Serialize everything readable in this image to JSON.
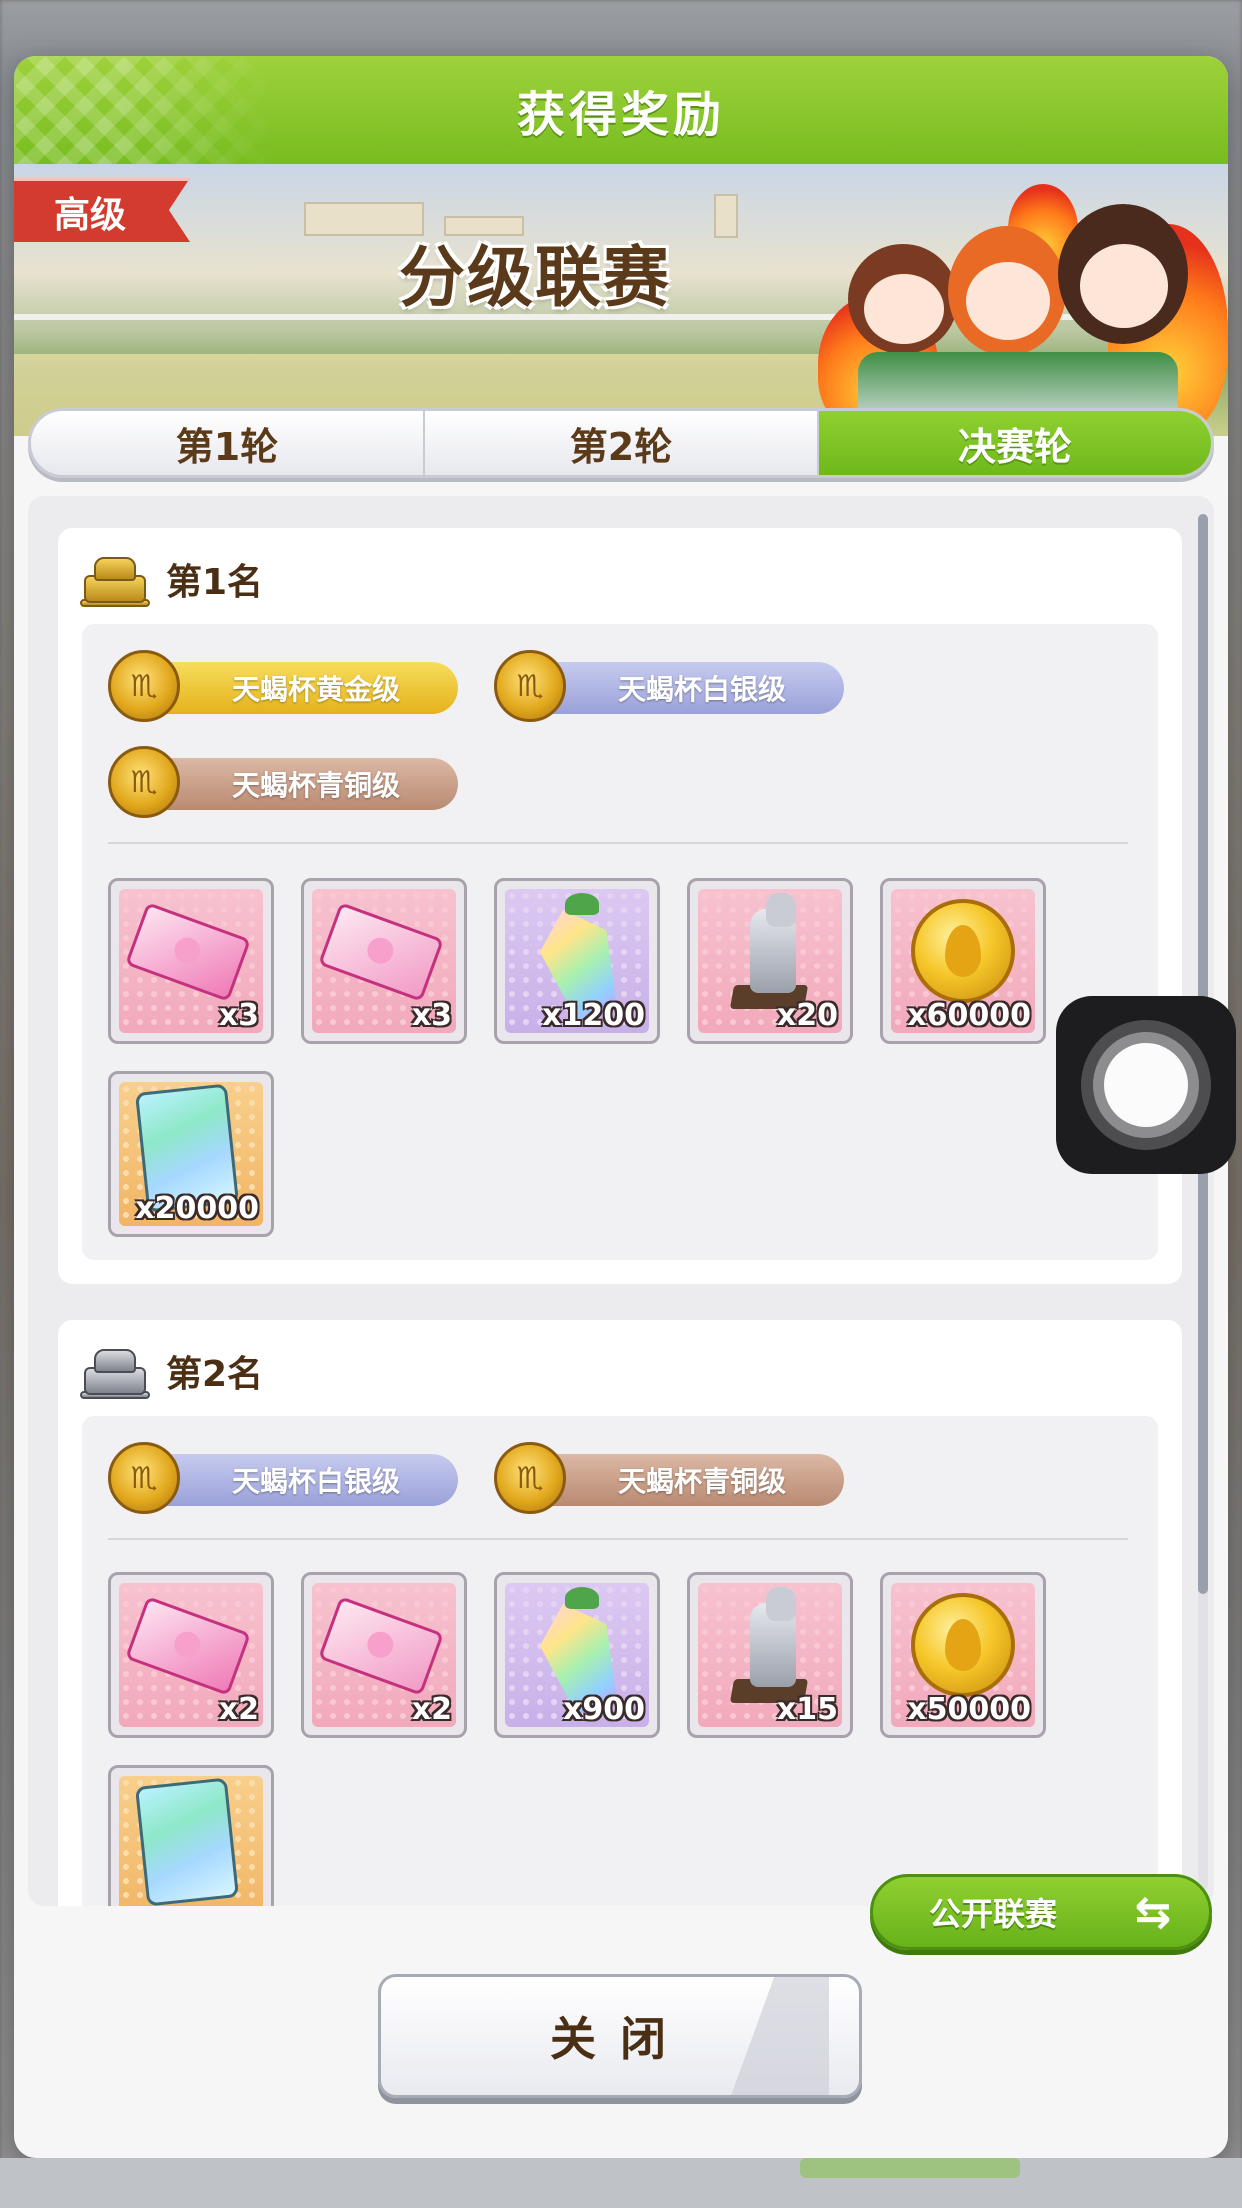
{
  "dialog": {
    "title": "获得奖励",
    "banner": {
      "grade": "高级",
      "title": "分级联赛"
    },
    "tabs": [
      {
        "label": "第1轮",
        "active": false
      },
      {
        "label": "第2轮",
        "active": false
      },
      {
        "label": "决赛轮",
        "active": true
      }
    ],
    "ranks": [
      {
        "label": "第1名",
        "trophy": "gold-trophy-icon",
        "badges": [
          {
            "label": "天蝎杯黄金级",
            "tier": "gold"
          },
          {
            "label": "天蝎杯白银级",
            "tier": "silver"
          },
          {
            "label": "天蝎杯青铜级",
            "tier": "bronze"
          }
        ],
        "items": [
          {
            "icon": "pink-ticket-icon",
            "qty": "x3"
          },
          {
            "icon": "pink-ticket-icon",
            "qty": "x3"
          },
          {
            "icon": "carrot-gem-icon",
            "qty": "x1200"
          },
          {
            "icon": "silver-statue-icon",
            "qty": "x20"
          },
          {
            "icon": "gold-coin-icon",
            "qty": "x60000"
          },
          {
            "icon": "rainbow-card-icon",
            "qty": "x20000"
          }
        ]
      },
      {
        "label": "第2名",
        "trophy": "silver-trophy-icon",
        "badges": [
          {
            "label": "天蝎杯白银级",
            "tier": "silver"
          },
          {
            "label": "天蝎杯青铜级",
            "tier": "bronze"
          }
        ],
        "items": [
          {
            "icon": "pink-ticket-icon",
            "qty": "x2"
          },
          {
            "icon": "pink-ticket-icon",
            "qty": "x2"
          },
          {
            "icon": "carrot-gem-icon",
            "qty": "x900"
          },
          {
            "icon": "silver-statue-icon",
            "qty": "x15"
          },
          {
            "icon": "gold-coin-icon",
            "qty": "x50000"
          },
          {
            "icon": "rainbow-card-icon",
            "qty": ""
          }
        ]
      }
    ],
    "public_button": {
      "label": "公开联赛",
      "icon": "swap-arrows-icon"
    },
    "close_button": {
      "label": "关闭"
    }
  },
  "colors": {
    "accent_green": "#78bd20",
    "text_brown": "#4a2f14",
    "tag_red": "#d33b2e"
  }
}
